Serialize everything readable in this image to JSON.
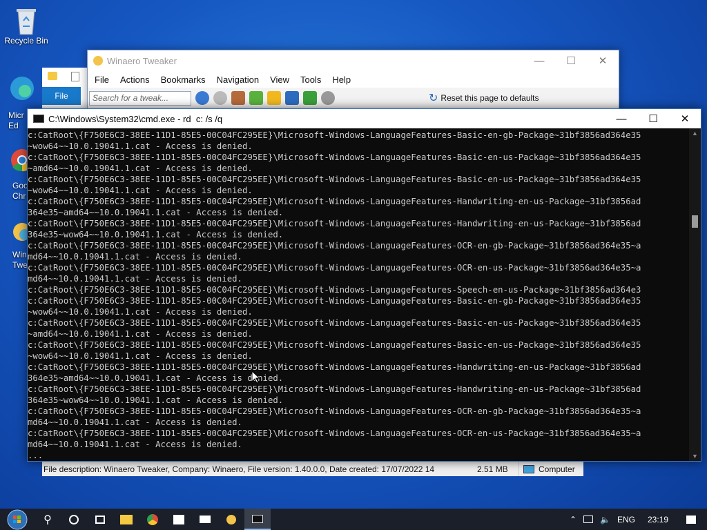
{
  "desktop": {
    "recycle_bin": "Recycle Bin",
    "frag_edge": "Micr\nEd",
    "frag_chrome": "Goo\nChr",
    "frag_winaero": "Win\nTwe"
  },
  "winaero": {
    "title": "Winaero Tweaker",
    "menu": [
      "File",
      "Actions",
      "Bookmarks",
      "Navigation",
      "View",
      "Tools",
      "Help"
    ],
    "search_placeholder": "Search for a tweak...",
    "reset_label": "Reset this page to defaults"
  },
  "explorer": {
    "file_tab": "File"
  },
  "status": {
    "description": "File description: Winaero Tweaker, Company: Winaero, File version: 1.40.0.0, Date created: 17/07/2022 14",
    "size": "2.51 MB",
    "computer": "Computer"
  },
  "cmd": {
    "title": "C:\\Windows\\System32\\cmd.exe - rd  c: /s /q",
    "lines": [
      "c:CatRoot\\{F750E6C3-38EE-11D1-85E5-00C04FC295EE}\\Microsoft-Windows-LanguageFeatures-Basic-en-gb-Package~31bf3856ad364e35",
      "~wow64~~10.0.19041.1.cat - Access is denied.",
      "c:CatRoot\\{F750E6C3-38EE-11D1-85E5-00C04FC295EE}\\Microsoft-Windows-LanguageFeatures-Basic-en-us-Package~31bf3856ad364e35",
      "~amd64~~10.0.19041.1.cat - Access is denied.",
      "c:CatRoot\\{F750E6C3-38EE-11D1-85E5-00C04FC295EE}\\Microsoft-Windows-LanguageFeatures-Basic-en-us-Package~31bf3856ad364e35",
      "~wow64~~10.0.19041.1.cat - Access is denied.",
      "c:CatRoot\\{F750E6C3-38EE-11D1-85E5-00C04FC295EE}\\Microsoft-Windows-LanguageFeatures-Handwriting-en-us-Package~31bf3856ad",
      "364e35~amd64~~10.0.19041.1.cat - Access is denied.",
      "c:CatRoot\\{F750E6C3-38EE-11D1-85E5-00C04FC295EE}\\Microsoft-Windows-LanguageFeatures-Handwriting-en-us-Package~31bf3856ad",
      "364e35~wow64~~10.0.19041.1.cat - Access is denied.",
      "c:CatRoot\\{F750E6C3-38EE-11D1-85E5-00C04FC295EE}\\Microsoft-Windows-LanguageFeatures-OCR-en-gb-Package~31bf3856ad364e35~a",
      "md64~~10.0.19041.1.cat - Access is denied.",
      "c:CatRoot\\{F750E6C3-38EE-11D1-85E5-00C04FC295EE}\\Microsoft-Windows-LanguageFeatures-OCR-en-us-Package~31bf3856ad364e35~a",
      "md64~~10.0.19041.1.cat - Access is denied.",
      "c:CatRoot\\{F750E6C3-38EE-11D1-85E5-00C04FC295EE}\\Microsoft-Windows-LanguageFeatures-Speech-en-us-Package~31bf3856ad364e3",
      "c:CatRoot\\{F750E6C3-38EE-11D1-85E5-00C04FC295EE}\\Microsoft-Windows-LanguageFeatures-Basic-en-gb-Package~31bf3856ad364e35",
      "~wow64~~10.0.19041.1.cat - Access is denied.",
      "c:CatRoot\\{F750E6C3-38EE-11D1-85E5-00C04FC295EE}\\Microsoft-Windows-LanguageFeatures-Basic-en-us-Package~31bf3856ad364e35",
      "~amd64~~10.0.19041.1.cat - Access is denied.",
      "c:CatRoot\\{F750E6C3-38EE-11D1-85E5-00C04FC295EE}\\Microsoft-Windows-LanguageFeatures-Basic-en-us-Package~31bf3856ad364e35",
      "~wow64~~10.0.19041.1.cat - Access is denied.",
      "c:CatRoot\\{F750E6C3-38EE-11D1-85E5-00C04FC295EE}\\Microsoft-Windows-LanguageFeatures-Handwriting-en-us-Package~31bf3856ad",
      "364e35~amd64~~10.0.19041.1.cat - Access is denied.",
      "c:CatRoot\\{F750E6C3-38EE-11D1-85E5-00C04FC295EE}\\Microsoft-Windows-LanguageFeatures-Handwriting-en-us-Package~31bf3856ad",
      "364e35~wow64~~10.0.19041.1.cat - Access is denied.",
      "c:CatRoot\\{F750E6C3-38EE-11D1-85E5-00C04FC295EE}\\Microsoft-Windows-LanguageFeatures-OCR-en-gb-Package~31bf3856ad364e35~a",
      "md64~~10.0.19041.1.cat - Access is denied.",
      "c:CatRoot\\{F750E6C3-38EE-11D1-85E5-00C04FC295EE}\\Microsoft-Windows-LanguageFeatures-OCR-en-us-Package~31bf3856ad364e35~a",
      "md64~~10.0.19041.1.cat - Access is denied.",
      "..."
    ]
  },
  "taskbar": {
    "tray_lang": "ENG",
    "clock": "23:19"
  },
  "icons": [
    "recycle-bin-icon",
    "edge-icon",
    "chrome-icon",
    "winaero-icon",
    "search-icon",
    "cortana-icon",
    "task-view-icon",
    "file-explorer-icon",
    "store-icon",
    "mail-icon",
    "cmd-icon",
    "network-icon",
    "volume-muted-icon",
    "notification-icon"
  ]
}
